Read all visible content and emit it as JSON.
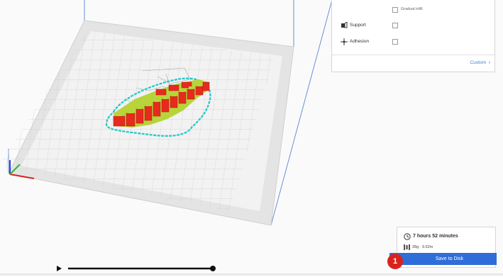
{
  "settings": {
    "gradual_infill_label": "Gradual infill",
    "support_label": "Support",
    "adhesion_label": "Adhesion",
    "custom_button_label": "Custom",
    "gradual_infill_checked": false,
    "support_checked": false,
    "adhesion_checked": false
  },
  "print": {
    "time_estimate": "7 hours 52 minutes",
    "material_estimate": "28g · 9.52m",
    "save_button_label": "Save to Disk"
  },
  "callout": {
    "number": "1"
  },
  "colors": {
    "accent": "#2f6dd8",
    "badge": "#d8231d",
    "model_walls": "#e82a1e",
    "model_infill": "#b7d43a",
    "skirt": "#1ec8c8"
  },
  "icons": [
    "support-icon",
    "adhesion-icon",
    "clock-icon",
    "spool-icon",
    "chevron-right-icon",
    "play-icon"
  ],
  "timeline": {
    "progress": 1.0
  }
}
